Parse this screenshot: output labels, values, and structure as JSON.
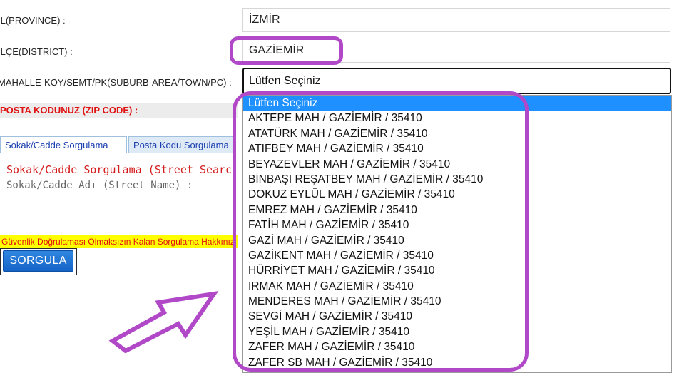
{
  "form": {
    "province_label": "İL(PROVINCE) :",
    "province_value": "İZMİR",
    "district_label": "İLÇE(DISTRICT) :",
    "district_value": "GAZİEMİR",
    "suburb_label": "MAHALLE-KÖY/SEMT/PK(SUBURB-AREA/TOWN/PC) :",
    "suburb_value": "Lütfen Seçiniz",
    "zip_label": "POSTA KODUNUZ (ZIP CODE) :"
  },
  "tabs": [
    {
      "label": "Sokak/Cadde Sorgulama"
    },
    {
      "label": "Posta Kodu Sorgulama"
    }
  ],
  "street": {
    "title": "Sokak/Cadde Sorgulama (Street Search)",
    "name_label": "Sokak/Cadde Adı (Street Name) :"
  },
  "security_notice": "Güvenlik Doğrulaması Olmaksızın Kalan Sorgulama Hakkınız",
  "query_button": "SORGULA",
  "dropdown": {
    "options": [
      "Lütfen Seçiniz",
      "AKTEPE MAH / GAZİEMİR / 35410",
      "ATATÜRK MAH / GAZİEMİR / 35410",
      "ATIFBEY MAH / GAZİEMİR / 35410",
      "BEYAZEVLER MAH / GAZİEMİR / 35410",
      "BİNBAŞI REŞATBEY MAH / GAZİEMİR / 35410",
      "DOKUZ EYLÜL MAH / GAZİEMİR / 35410",
      "EMREZ MAH / GAZİEMİR / 35410",
      "FATİH MAH / GAZİEMİR / 35410",
      "GAZİ MAH / GAZİEMİR / 35410",
      "GAZİKENT MAH / GAZİEMİR / 35410",
      "HÜRRİYET MAH / GAZİEMİR / 35410",
      "IRMAK MAH / GAZİEMİR / 35410",
      "MENDERES MAH / GAZİEMİR / 35410",
      "SEVGİ MAH / GAZİEMİR / 35410",
      "YEŞİL MAH / GAZİEMİR / 35410",
      "ZAFER MAH / GAZİEMİR / 35410",
      "ZAFER SB MAH / GAZİEMİR / 35410"
    ],
    "selected_index": 0
  },
  "colors": {
    "highlight": "#b048c8",
    "selected_option": "#1e90ff",
    "label_red": "#e01010",
    "button_blue": "#1e6fd0"
  }
}
